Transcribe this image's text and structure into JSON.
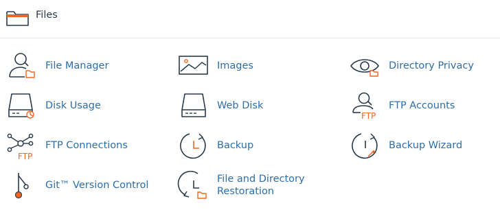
{
  "section": {
    "title": "Files",
    "icon": "folder-icon"
  },
  "colors": {
    "link": "#2d6ea8",
    "icon_stroke": "#293a4a",
    "accent": "#f26522",
    "divider": "#e6e6e6"
  },
  "items": [
    {
      "label": "File Manager",
      "icon": "file-manager-icon"
    },
    {
      "label": "Images",
      "icon": "images-icon"
    },
    {
      "label": "Directory Privacy",
      "icon": "directory-privacy-icon"
    },
    {
      "label": "Disk Usage",
      "icon": "disk-usage-icon"
    },
    {
      "label": "Web Disk",
      "icon": "web-disk-icon"
    },
    {
      "label": "FTP Accounts",
      "icon": "ftp-accounts-icon",
      "icon_text": "FTP"
    },
    {
      "label": "FTP Connections",
      "icon": "ftp-connections-icon",
      "icon_text": "FTP"
    },
    {
      "label": "Backup",
      "icon": "backup-icon"
    },
    {
      "label": "Backup Wizard",
      "icon": "backup-wizard-icon"
    },
    {
      "label": "Git™ Version Control",
      "icon": "git-version-control-icon"
    },
    {
      "label": "File and Directory Restoration",
      "label_lines": [
        "File and Directory",
        "Restoration"
      ],
      "icon": "file-directory-restoration-icon"
    }
  ]
}
